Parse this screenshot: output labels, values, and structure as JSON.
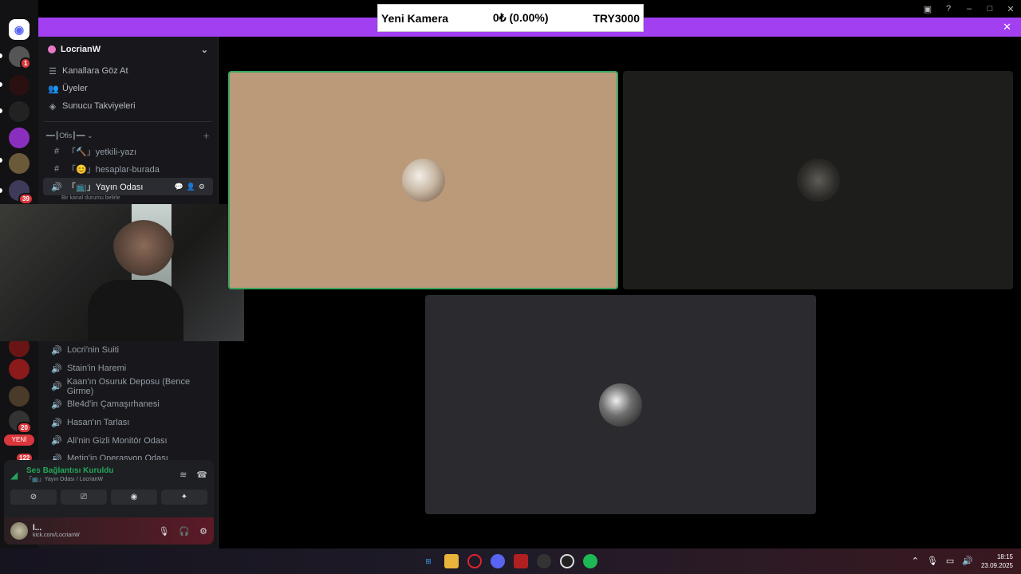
{
  "ticker": {
    "name": "Yeni Kamera",
    "change": "0₺ (0.00%)",
    "price": "TRY3000"
  },
  "rail": {
    "badges": [
      "1",
      "39",
      "20",
      "122"
    ],
    "new_label": "YENİ"
  },
  "guild": {
    "name": "LocrianW"
  },
  "nav": [
    {
      "label": "Kanallara Göz At",
      "icon": "browse-channels-icon"
    },
    {
      "label": "Üyeler",
      "icon": "members-icon"
    },
    {
      "label": "Sunucu Takviyeleri",
      "icon": "boost-icon"
    }
  ],
  "category": {
    "label": "━━┃Ofis┃━━"
  },
  "text_channels": [
    {
      "label": "「🔨」yetkili-yazı"
    },
    {
      "label": "「😊」hesaplar-burada"
    }
  ],
  "active_channel": {
    "label": "「📺」Yayın Odası",
    "status": "Bir kanal durumu belirle"
  },
  "voice_channels": [
    "Locri'nin Suiti",
    "Stain'in Haremi",
    "Kaan'ın Osuruk Deposu (Bence Girme)",
    "Ble4d'in Çamaşırhanesi",
    "Hasan'ın Tarlası",
    "Ali'nin Gizli Monitör Odası",
    "Metin'in Operasyon Odası"
  ],
  "voice_panel": {
    "status": "Ses Bağlantısı Kuruldu",
    "location": "「📺」Yayın Odası / LocrianW"
  },
  "user": {
    "name": "l...",
    "status": "kick.com/LocrianW"
  },
  "clock": {
    "time": "18:15",
    "date": "23.09.2025"
  },
  "colors": {
    "accent": "#a23ff0",
    "speaking": "#3ba55d",
    "connected": "#23a55a"
  }
}
